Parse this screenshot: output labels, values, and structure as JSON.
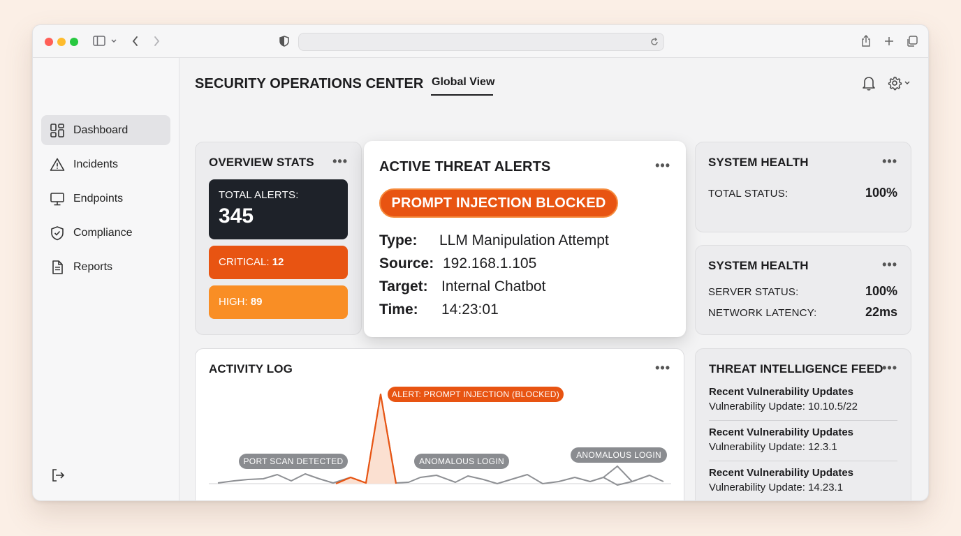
{
  "browser": {
    "controls": [
      "sidebar-toggle-icon",
      "back-icon",
      "forward-icon",
      "shield-icon",
      "reload-icon",
      "share-icon",
      "new-tab-icon",
      "tabs-overview-icon"
    ]
  },
  "sidebar": {
    "items": [
      {
        "label": "Dashboard",
        "icon": "dashboard-icon",
        "active": true
      },
      {
        "label": "Incidents",
        "icon": "warning-icon",
        "active": false
      },
      {
        "label": "Endpoints",
        "icon": "monitor-icon",
        "active": false
      },
      {
        "label": "Compliance",
        "icon": "shield-check-icon",
        "active": false
      },
      {
        "label": "Reports",
        "icon": "document-icon",
        "active": false
      }
    ]
  },
  "header": {
    "title": "SECURITY OPERATIONS CENTER",
    "tab": "Global View"
  },
  "overview": {
    "title": "OVERVIEW STATS",
    "total_label": "TOTAL ALERTS:",
    "total_value": "345",
    "critical_label": "CRITICAL:",
    "critical_value": "12",
    "high_label": "HIGH:",
    "high_value": "89"
  },
  "threat_alert": {
    "title": "ACTIVE THREAT ALERTS",
    "badge": "PROMPT INJECTION BLOCKED",
    "type_label": "Type:",
    "type_value": "LLM Manipulation Attempt",
    "source_label": "Source:",
    "source_value": "192.168.1.105",
    "target_label": "Target:",
    "target_value": "Internal Chatbot",
    "time_label": "Time:",
    "time_value": "14:23:01"
  },
  "health1": {
    "title": "SYSTEM HEALTH",
    "label": "TOTAL STATUS:",
    "value": "100%"
  },
  "health2": {
    "title": "SYSTEM HEALTH",
    "server_label": "SERVER STATUS:",
    "server_value": "100%",
    "latency_label": "NETWORK LATENCY:",
    "latency_value": "22ms"
  },
  "activity": {
    "title": "ACTIVITY LOG",
    "annotations": {
      "spike": "ALERT: PROMPT INJECTION (BLOCKED)",
      "port_scan": "PORT SCAN DETECTED",
      "login1": "ANOMALOUS LOGIN",
      "login2": "ANOMALOUS LOGIN"
    }
  },
  "feed": {
    "title": "THREAT INTELLIGENCE FEED",
    "items": [
      {
        "title": "Recent Vulnerability Updates",
        "sub": "Vulnerability Update: 10.10.5/22"
      },
      {
        "title": "Recent Vulnerability Updates",
        "sub": "Vulnerability Update: 12.3.1"
      },
      {
        "title": "Recent Vulnerability Updates",
        "sub": "Vulnerability Update: 14.23.1"
      }
    ]
  },
  "colors": {
    "accent_orange": "#e85412",
    "high_orange": "#f98e25",
    "dark_card": "#1e2229"
  }
}
